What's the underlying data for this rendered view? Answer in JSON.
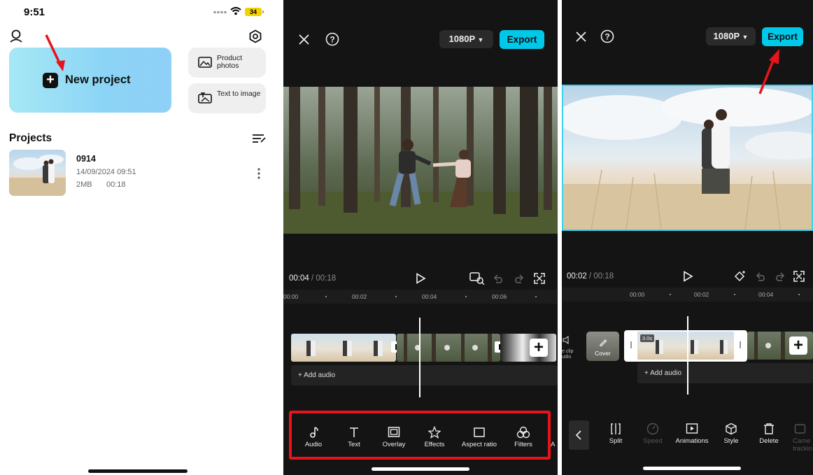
{
  "home": {
    "status": {
      "time": "9:51",
      "battery": "34"
    },
    "new_project": {
      "label": "New project"
    },
    "side_cards": [
      {
        "label": "Product photos",
        "icon": "product-photos-icon"
      },
      {
        "label": "Text to image",
        "icon": "text-to-image-icon"
      }
    ],
    "projects": {
      "title": "Projects",
      "items": [
        {
          "name": "0914",
          "date": "14/09/2024 09:51",
          "size": "2MB",
          "duration": "00:18"
        }
      ]
    }
  },
  "editor_1": {
    "resolution": "1080P",
    "export_label": "Export",
    "time_current": "00:04",
    "time_separator": "/",
    "time_total": "00:18",
    "ruler": [
      "00:00",
      "00:02",
      "00:04",
      "00:06"
    ],
    "add_audio": "Add audio",
    "tools": [
      {
        "label": "Audio",
        "icon": "music-note-icon"
      },
      {
        "label": "Text",
        "icon": "text-icon"
      },
      {
        "label": "Overlay",
        "icon": "overlay-icon"
      },
      {
        "label": "Effects",
        "icon": "effects-star-icon"
      },
      {
        "label": "Aspect ratio",
        "icon": "aspect-ratio-icon"
      },
      {
        "label": "Filters",
        "icon": "filters-icon"
      },
      {
        "label": "A",
        "icon": "more-icon"
      }
    ]
  },
  "editor_2": {
    "resolution": "1080P",
    "export_label": "Export",
    "time_current": "00:02",
    "time_separator": "/",
    "time_total": "00:18",
    "ruler": [
      "00:00",
      "00:02",
      "00:04"
    ],
    "cover_label": "Cover",
    "clip_badge": "3.0s",
    "mute_label_1": "e clip",
    "mute_label_2": "udio",
    "add_audio": "Add audio",
    "tools": [
      {
        "label": "Split",
        "icon": "split-icon",
        "enabled": true
      },
      {
        "label": "Speed",
        "icon": "speed-icon",
        "enabled": false
      },
      {
        "label": "Animations",
        "icon": "animations-icon",
        "enabled": true
      },
      {
        "label": "Style",
        "icon": "style-cube-icon",
        "enabled": true
      },
      {
        "label": "Delete",
        "icon": "delete-icon",
        "enabled": true
      },
      {
        "label": "Came",
        "label2": "trackin",
        "icon": "camera-tracking-icon",
        "enabled": false
      }
    ]
  },
  "colors": {
    "accent": "#00c8e8",
    "annotation_red": "#e8131b",
    "editor_bg": "#141414"
  }
}
